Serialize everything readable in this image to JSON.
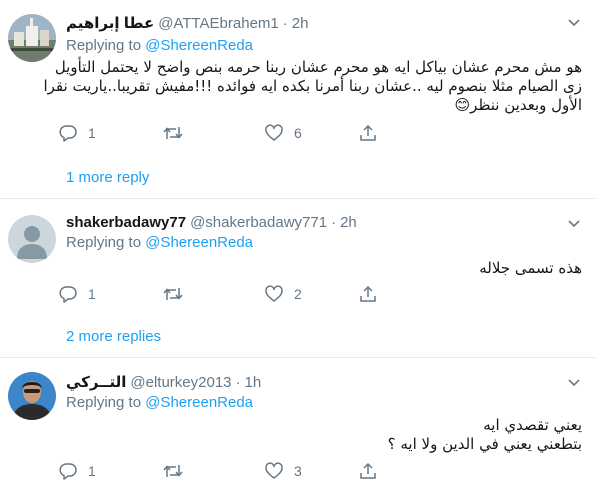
{
  "tweets": [
    {
      "name": "عطا إبراهيم",
      "handle": "@ATTAEbrahem1",
      "sep": "·",
      "time": "2h",
      "replying_prefix": "Replying to ",
      "replying_to": "@ShereenReda",
      "text_lines": [
        "هو مش محرم عشان بياكل ايه هو محرم عشان ربنا حرمه بنص واضح لا يحتمل التأويل",
        "زى الصيام مثلا بنصوم ليه ..عشان ربنا أمرنا بكده ايه فوائده !!!مفيش تقريبا..ياريت نقرا",
        "الأول وبعدين ننظر😊"
      ],
      "reply_count": "1",
      "retweet_count": "",
      "like_count": "6",
      "more_replies": "1 more reply"
    },
    {
      "name": "shakerbadawy77",
      "handle": "@shakerbadawy771",
      "sep": "·",
      "time": "2h",
      "replying_prefix": "Replying to ",
      "replying_to": "@ShereenReda",
      "text_lines": [
        "هذه تسمى جلاله"
      ],
      "reply_count": "1",
      "retweet_count": "",
      "like_count": "2",
      "more_replies": "2 more replies"
    },
    {
      "name": "التــركي",
      "handle": "@elturkey2013",
      "sep": "·",
      "time": "1h",
      "replying_prefix": "Replying to ",
      "replying_to": "@ShereenReda",
      "text_lines": [
        "يعني تقصدي ايه",
        "بتطعني يعني في الدين ولا ايه ؟"
      ],
      "reply_count": "1",
      "retweet_count": "",
      "like_count": "3"
    }
  ],
  "icons": {
    "caret": "chevron-down-icon",
    "reply": "reply-icon",
    "retweet": "retweet-icon",
    "like": "heart-icon",
    "share": "share-icon"
  },
  "colors": {
    "link": "#1da1f2",
    "muted": "#657786",
    "text": "#14171a",
    "divider": "#e6ecf0"
  }
}
